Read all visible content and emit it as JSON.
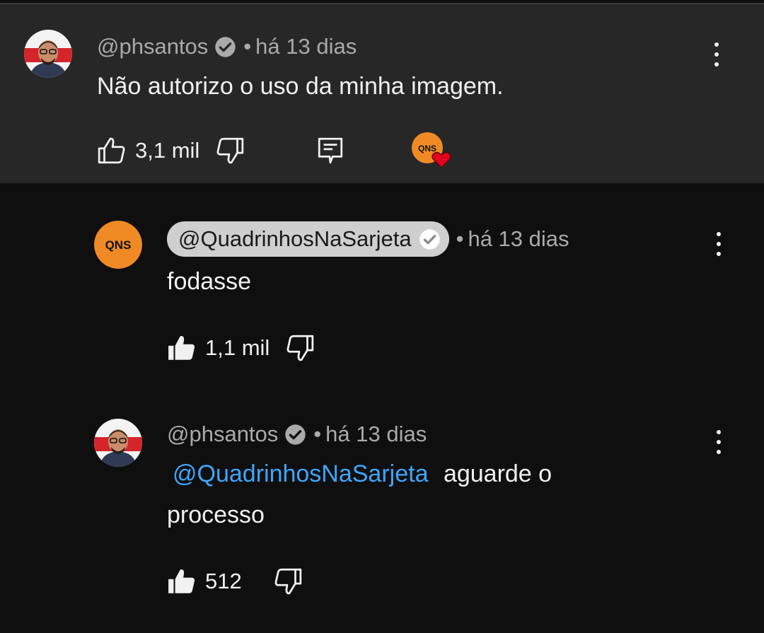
{
  "thread": {
    "comment": {
      "handle": "@phsantos",
      "time": "há 13 dias",
      "text": "Não autorizo o uso da minha imagem.",
      "likes": "3,1 mil",
      "creator_heart_badge": "QNS",
      "avatar_icon": "person-avatar-icon"
    },
    "replies": [
      {
        "handle": "@QuadrinhosNaSarjeta",
        "time": "há 13 dias",
        "text": "fodasse",
        "likes": "1,1 mil",
        "avatar_text": "QNS",
        "highlighted_handle": true
      },
      {
        "handle": "@phsantos",
        "time": "há 13 dias",
        "mention": "@QuadrinhosNaSarjeta",
        "text_line1": "aguarde o",
        "text_line2": "processo",
        "likes": "512"
      }
    ]
  },
  "separator": "•",
  "colors": {
    "background": "#0f0f0f",
    "highlight_background": "#272727",
    "mention": "#3ea6ff",
    "qns_orange": "#f08a24",
    "heart_red": "#e0001e"
  }
}
